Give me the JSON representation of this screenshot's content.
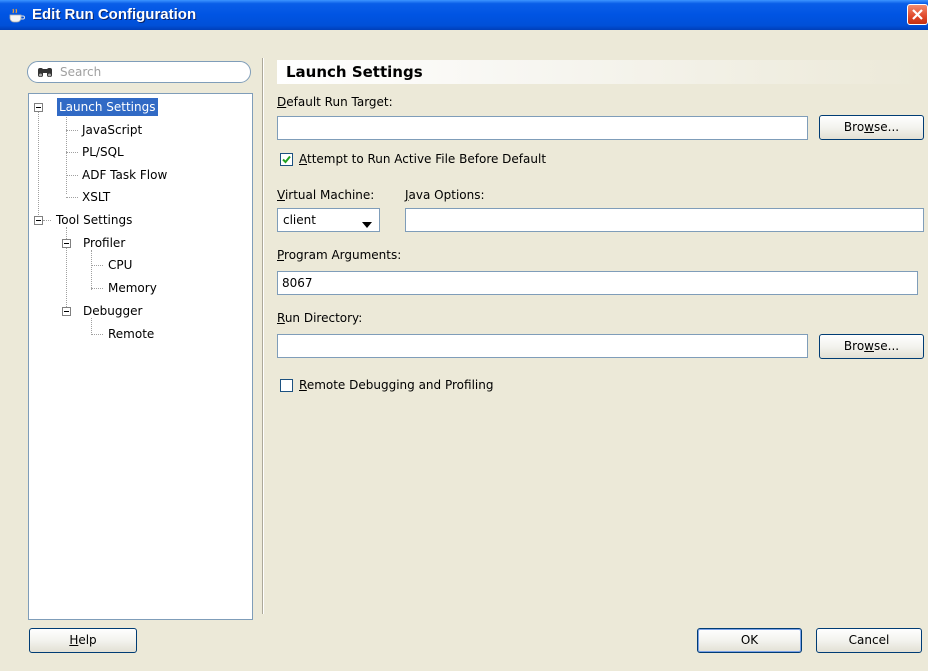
{
  "window": {
    "title": "Edit Run Configuration"
  },
  "search": {
    "placeholder": "Search"
  },
  "tree": [
    {
      "label": "Launch Settings",
      "selected": true
    },
    {
      "label": "JavaScript"
    },
    {
      "label": "PL/SQL"
    },
    {
      "label": "ADF Task Flow"
    },
    {
      "label": "XSLT"
    },
    {
      "label": "Tool Settings"
    },
    {
      "label": "Profiler"
    },
    {
      "label": "CPU"
    },
    {
      "label": "Memory"
    },
    {
      "label": "Debugger"
    },
    {
      "label": "Remote"
    }
  ],
  "section": {
    "title": "Launch Settings"
  },
  "form": {
    "default_run_target": {
      "label_u": "D",
      "label_rest": "efault Run Target:",
      "value": ""
    },
    "browse1": {
      "pre": "Bro",
      "u": "w",
      "post": "se..."
    },
    "attempt_active": {
      "checked": true,
      "label_u": "A",
      "label_rest": "ttempt to Run Active File Before Default"
    },
    "virtual_machine": {
      "label_u": "V",
      "label_rest": "irtual Machine:",
      "value": "client"
    },
    "java_options": {
      "label_u": "J",
      "label_rest": "ava Options:",
      "value": ""
    },
    "program_arguments": {
      "label_u": "P",
      "label_rest": "rogram Arguments:",
      "value": "8067"
    },
    "run_directory": {
      "label_u": "R",
      "label_rest": "un Directory:",
      "value": ""
    },
    "browse2": {
      "pre": "Bro",
      "u": "w",
      "post": "se..."
    },
    "remote_debugging": {
      "checked": false,
      "label_u": "R",
      "label_rest": "emote Debugging and Profiling"
    }
  },
  "footer": {
    "help": {
      "u": "H",
      "rest": "elp"
    },
    "ok": "OK",
    "cancel": "Cancel"
  },
  "colors": {
    "title_bar": "#0054e3",
    "selection": "#316ac5",
    "dialog_bg": "#ece9d8"
  }
}
